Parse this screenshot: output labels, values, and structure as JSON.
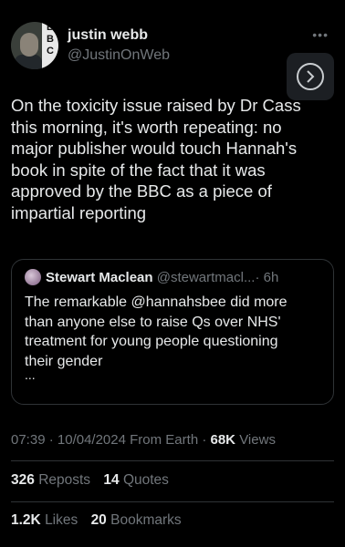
{
  "author": {
    "name": "justin webb",
    "handle": "@JustinOnWeb",
    "avatar_badge": [
      "B",
      "B",
      "C"
    ]
  },
  "more_icon": "more-dots-icon",
  "next_icon": "chevron-right-circle-icon",
  "tweet": {
    "lines": [
      "On the toxicity issue raised by Dr Cass",
      "this morning, it's worth repeating: no",
      "major publisher would touch  Hannah's",
      "book in spite of the fact that it was",
      "approved by the BBC as a piece of",
      "impartial reporting"
    ]
  },
  "quoted": {
    "name": "Stewart Maclean",
    "handle": "@stewartmacl...",
    "time": "· 6h",
    "lines": [
      "The remarkable @hannahsbee did more",
      "than anyone else to raise Qs over NHS'",
      "treatment for young people questioning",
      "their gender"
    ],
    "ellipsis": "..."
  },
  "meta": {
    "time": "07:39",
    "sep1": "·",
    "date": "10/04/2024",
    "source": "From Earth",
    "sep2": "·",
    "views_count": "68K",
    "views_label": "Views"
  },
  "stats": {
    "reposts_count": "326",
    "reposts_label": "Reposts",
    "quotes_count": "14",
    "quotes_label": "Quotes",
    "likes_count": "1.2K",
    "likes_label": "Likes",
    "bookmarks_count": "20",
    "bookmarks_label": "Bookmarks"
  }
}
